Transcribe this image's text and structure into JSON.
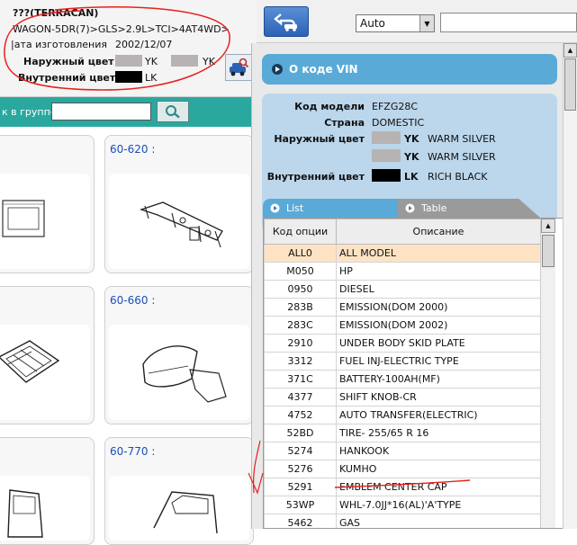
{
  "vehicle": {
    "title": "???(TERRACAN)",
    "subtitle": "WAGON-5DR(7)>GLS>2.9L>TCI>4AT4WD>",
    "date_label": "|ата изготовления",
    "date_value": "2002/12/07",
    "exterior_label": "Наружный цвет",
    "exterior_code_1": "YK",
    "exterior_code_2": "YK",
    "interior_label": "Внутренний цвет",
    "interior_code": "LK",
    "exterior_color": "#b8b3b3",
    "interior_color": "#000000"
  },
  "toolbar": {
    "select_value": "Auto",
    "input_value": ""
  },
  "group_search": {
    "label": "к в группе",
    "input_value": ""
  },
  "thumbnails": [
    {
      "code": "60-620 :",
      "icon": "dashboard-reinforcement-part"
    },
    {
      "code": "60-660 :",
      "icon": "hood-fender-part"
    },
    {
      "code": "60-770 :",
      "icon": "rear-door-part"
    }
  ],
  "vin_panel": {
    "header": "О коде VIN",
    "model_code_label": "Код модели",
    "model_code": "EFZG28C",
    "country_label": "Страна",
    "country": "DOMESTIC",
    "exterior_label": "Наружный цвет",
    "exterior_colors": [
      {
        "code": "YK",
        "name": "WARM SILVER",
        "hex": "#b8b3b3"
      },
      {
        "code": "YK",
        "name": "WARM SILVER",
        "hex": "#b8b3b3"
      }
    ],
    "interior_label": "Внутренний цвет",
    "interior_color": {
      "code": "LK",
      "name": "RICH BLACK",
      "hex": "#000000"
    },
    "tabs": {
      "list": "List",
      "table": "Table"
    }
  },
  "options_table": {
    "headers": [
      "Код опции",
      "Описание"
    ],
    "rows": [
      [
        "ALL0",
        "ALL MODEL"
      ],
      [
        "M050",
        "HP"
      ],
      [
        "0950",
        "DIESEL"
      ],
      [
        "283B",
        "EMISSION(DOM 2000)"
      ],
      [
        "283C",
        "EMISSION(DOM 2002)"
      ],
      [
        "2910",
        "UNDER BODY SKID PLATE"
      ],
      [
        "3312",
        "FUEL INJ-ELECTRIC TYPE"
      ],
      [
        "371C",
        "BATTERY-100AH(MF)"
      ],
      [
        "4377",
        "SHIFT KNOB-CR"
      ],
      [
        "4752",
        "AUTO TRANSFER(ELECTRIC)"
      ],
      [
        "52BD",
        "TIRE- 255/65  R 16"
      ],
      [
        "5274",
        "HANKOOK"
      ],
      [
        "5276",
        "KUMHO"
      ],
      [
        "5291",
        "EMBLEM CENTER CAP"
      ],
      [
        "53WP",
        "WHL-7.0JJ*16(AL)'A'TYPE"
      ],
      [
        "5462",
        "GAS"
      ]
    ],
    "selected_index": 0
  }
}
